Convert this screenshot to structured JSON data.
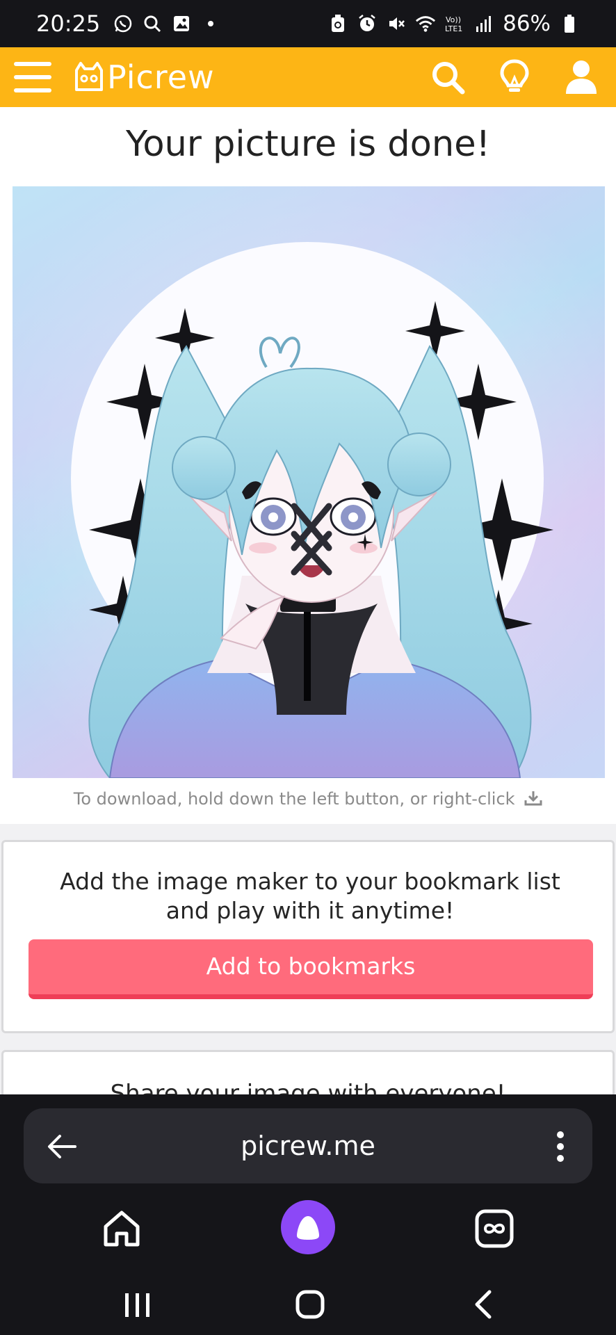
{
  "status_bar": {
    "time": "20:25",
    "battery": "86%"
  },
  "header": {
    "logo_text": "Picrew",
    "icons": [
      "menu-icon",
      "search-icon",
      "lightbulb-icon",
      "user-icon"
    ]
  },
  "main": {
    "title": "Your picture is done!",
    "download_hint": "To download, hold down the left button, or right-click"
  },
  "bookmark_card": {
    "text_line1": "Add the image maker to your bookmark list",
    "text_line2": "and play with it anytime!",
    "button_label": "Add to bookmarks"
  },
  "share_card": {
    "text": "Share your image with everyone!"
  },
  "browser": {
    "url": "picrew.me"
  },
  "colors": {
    "header_bg": "#fdb515",
    "button_bg": "#ff6b7c",
    "browser_bg": "#151519",
    "assistant_accent": "#8c48f7"
  }
}
